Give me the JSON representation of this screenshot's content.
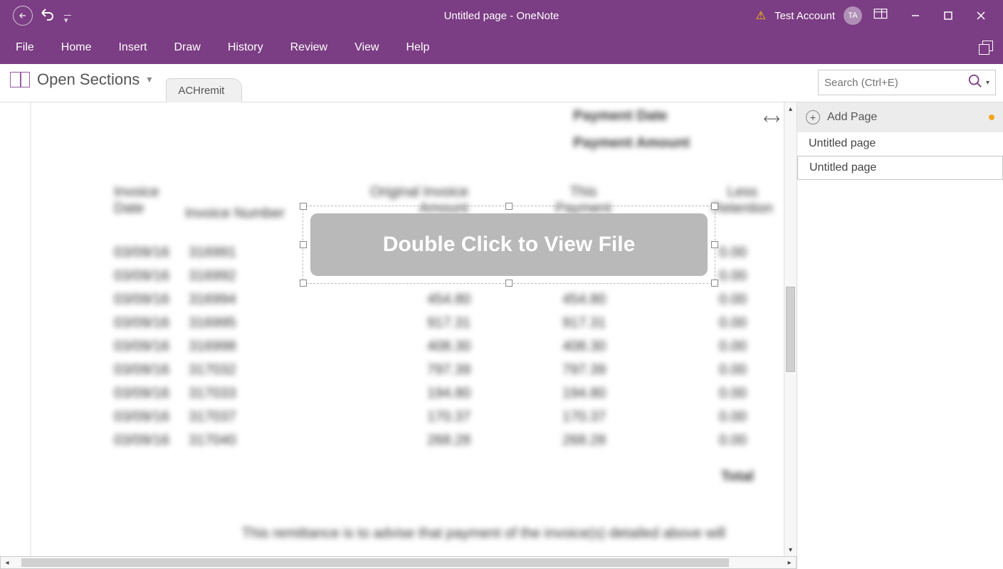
{
  "colors": {
    "brand": "#7b3d83",
    "accent": "#f5a623"
  },
  "title_bar": {
    "page_title": "Untitled page",
    "app_name": "OneNote",
    "separator": "  -  ",
    "account_name": "Test Account",
    "avatar_initials": "TA"
  },
  "ribbon": {
    "tabs": [
      "File",
      "Home",
      "Insert",
      "Draw",
      "History",
      "Review",
      "View",
      "Help"
    ]
  },
  "toolbar": {
    "open_sections_label": "Open Sections",
    "section_tab": "ACHremit",
    "search_placeholder": "Search (Ctrl+E)"
  },
  "canvas": {
    "overlay_text": "Double Click to View File",
    "header_right": {
      "line1": "Payment Date",
      "line2": "Payment Amount"
    },
    "col_headers": {
      "c1a": "Invoice",
      "c1b": "Date",
      "c2": "Invoice Number",
      "c3a": "Original Invoice",
      "c3b": "Amount",
      "c4a": "This",
      "c4b": "Payment",
      "c5a": "Less",
      "c5b": "Retention"
    },
    "rows": [
      {
        "date": "03/09/16",
        "num": "316991",
        "orig": "",
        "pay": "",
        "ret": "0.00"
      },
      {
        "date": "03/09/16",
        "num": "316992",
        "orig": "",
        "pay": "",
        "ret": "0.00"
      },
      {
        "date": "03/09/16",
        "num": "316994",
        "orig": "454.80",
        "pay": "454.80",
        "ret": "0.00"
      },
      {
        "date": "03/09/16",
        "num": "316995",
        "orig": "917.31",
        "pay": "917.31",
        "ret": "0.00"
      },
      {
        "date": "03/09/16",
        "num": "316998",
        "orig": "408.30",
        "pay": "408.30",
        "ret": "0.00"
      },
      {
        "date": "03/09/16",
        "num": "317032",
        "orig": "797.39",
        "pay": "797.39",
        "ret": "0.00"
      },
      {
        "date": "03/09/16",
        "num": "317033",
        "orig": "194.80",
        "pay": "194.80",
        "ret": "0.00"
      },
      {
        "date": "03/09/16",
        "num": "317037",
        "orig": "170.37",
        "pay": "170.37",
        "ret": "0.00"
      },
      {
        "date": "03/09/16",
        "num": "317040",
        "orig": "268.28",
        "pay": "268.28",
        "ret": "0.00"
      }
    ],
    "total_label": "Total",
    "footer": "This remittance is to advise that payment of the invoice(s) detailed above will"
  },
  "sidebar": {
    "add_page_label": "Add Page",
    "pages": [
      "Untitled page",
      "Untitled page"
    ],
    "selected_index": 1
  }
}
